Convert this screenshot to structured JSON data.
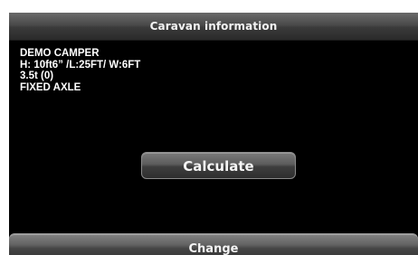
{
  "header": {
    "title": "Caravan information"
  },
  "caravan": {
    "name": "DEMO CAMPER",
    "dimensions": "H: 10ft6” /L:25FT/ W:6FT",
    "weight": "3.5t (0)",
    "axle": "FIXED AXLE"
  },
  "actions": {
    "calculate_label": "Calculate",
    "change_label": "Change"
  },
  "colors": {
    "background": "#000000",
    "text": "#ffffff",
    "button_gradient_top": "#7a7a7a",
    "button_gradient_bottom": "#2e2e2e"
  }
}
